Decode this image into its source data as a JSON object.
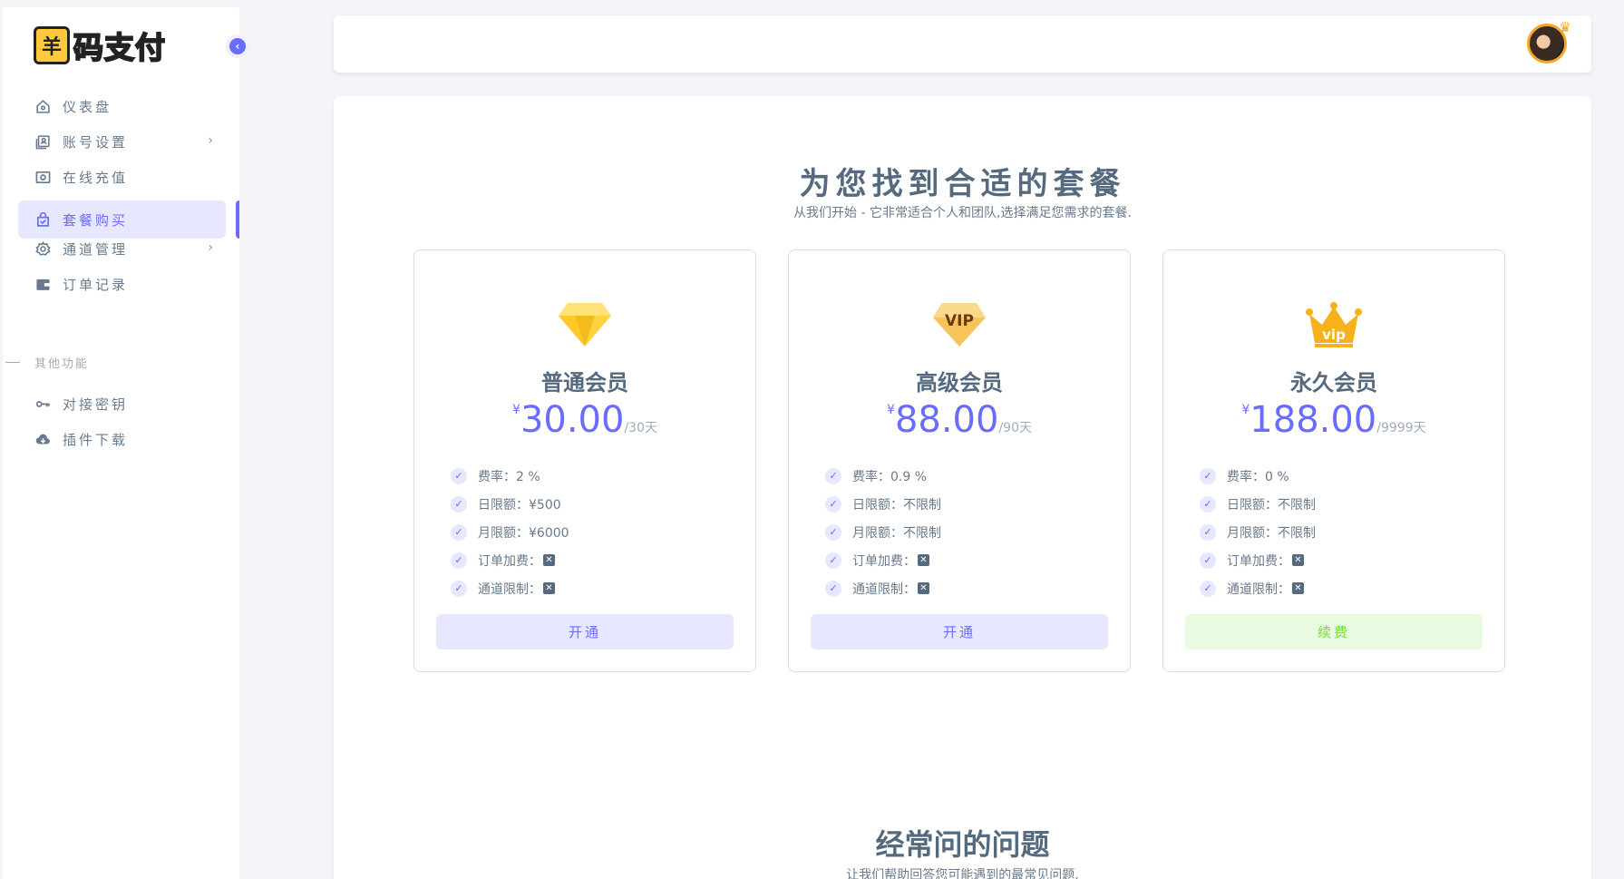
{
  "brand": {
    "logo_glyph": "羊",
    "logo_text": "码支付"
  },
  "sidebar": {
    "items": [
      {
        "label": "仪表盘",
        "icon": "home-icon",
        "has_chevron": false
      },
      {
        "label": "账号设置",
        "icon": "user-card-icon",
        "has_chevron": true
      },
      {
        "label": "在线充值",
        "icon": "money-icon",
        "has_chevron": false
      },
      {
        "label": "套餐购买",
        "icon": "shopping-bag-icon",
        "has_chevron": false,
        "active": true
      },
      {
        "label": "通道管理",
        "icon": "gear-icon",
        "has_chevron": true
      },
      {
        "label": "订单记录",
        "icon": "wallet-icon",
        "has_chevron": false
      }
    ],
    "section_header": "其他功能",
    "extra_items": [
      {
        "label": "对接密钥",
        "icon": "key-icon"
      },
      {
        "label": "插件下载",
        "icon": "cloud-download-icon"
      }
    ],
    "chevron": "›"
  },
  "pricing": {
    "title": "为您找到合适的套餐",
    "subtitle": "从我们开始 - 它非常适合个人和团队,选择满足您需求的套餐.",
    "plans": [
      {
        "icon": "diamond-icon",
        "name": "普通会员",
        "currency": "¥",
        "price": "30.00",
        "period": "/30天",
        "features": [
          "费率：2 %",
          "日限额：¥500",
          "月限额：¥6000",
          "订单加费：",
          "通道限制："
        ],
        "button": "开通"
      },
      {
        "icon": "vip-badge-icon",
        "name": "高级会员",
        "currency": "¥",
        "price": "88.00",
        "period": "/90天",
        "features": [
          "费率：0.9 %",
          "日限额：不限制",
          "月限额：不限制",
          "订单加费：",
          "通道限制："
        ],
        "button": "开通"
      },
      {
        "icon": "vip-crown-icon",
        "name": "永久会员",
        "currency": "¥",
        "price": "188.00",
        "period": "/9999天",
        "features": [
          "费率：0 %",
          "日限额：不限制",
          "月限额：不限制",
          "订单加费：",
          "通道限制："
        ],
        "button": "续费"
      }
    ]
  },
  "faq": {
    "title": "经常问的问题",
    "subtitle": "让我们帮助回答您可能遇到的最常见问题."
  },
  "colors": {
    "primary": "#696cff",
    "success": "#71dd37",
    "text": "#566a7f"
  }
}
